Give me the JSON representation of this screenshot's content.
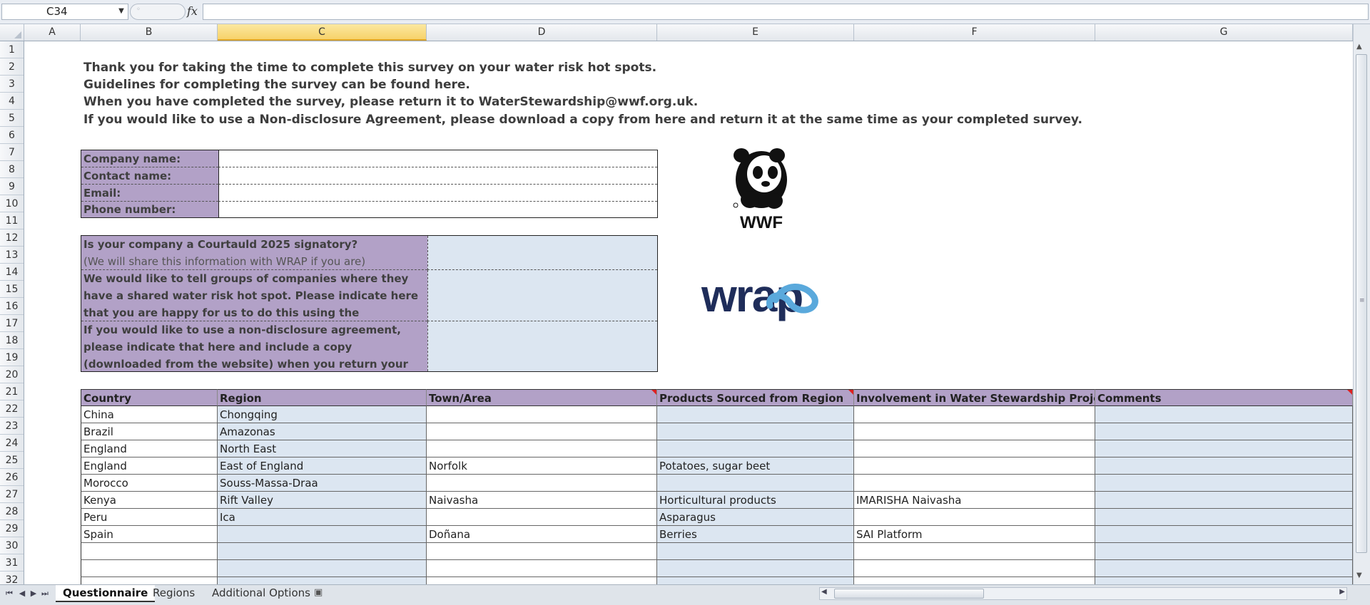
{
  "formula_bar": {
    "name_box": "C34",
    "formula": ""
  },
  "columns": [
    "A",
    "B",
    "C",
    "D",
    "E",
    "F",
    "G"
  ],
  "selected_column": "C",
  "rows": [
    "1",
    "2",
    "3",
    "4",
    "5",
    "6",
    "7",
    "8",
    "9",
    "10",
    "11",
    "12",
    "13",
    "14",
    "15",
    "16",
    "17",
    "18",
    "19",
    "20",
    "21",
    "22",
    "23",
    "24",
    "25",
    "26",
    "27",
    "28",
    "29",
    "30",
    "31",
    "32"
  ],
  "intro": [
    "Thank you for taking the time to complete this survey on your water risk hot spots.",
    "Guidelines for completing the survey can be found here.",
    "When you have completed the survey, please return it to WaterStewardship@wwf.org.uk.",
    "If you would like to use a Non-disclosure Agreement, please download a copy from here and return it at the same time as your completed survey."
  ],
  "contact_fields": [
    "Company name:",
    "Contact name:",
    "Email:",
    "Phone number:"
  ],
  "questions": {
    "courtauld": "Is your company a Courtauld 2025 signatory?",
    "courtauld_note": "(We will share this information with WRAP if you are)",
    "share": "We would like to tell groups of companies where they have a shared water risk hot spot. Please indicate here that you are happy for us to do this using the information you provide.",
    "nda": "If you would like to use a non-disclosure agreement, please indicate that here and include a copy (downloaded from the website) when you return your survey."
  },
  "logos": {
    "wwf": "WWF",
    "wrap": "wrap"
  },
  "table": {
    "headers": [
      "Country",
      "Region",
      "Town/Area",
      "Products Sourced from Region",
      "Involvement in Water Stewardship Projects",
      "Comments"
    ],
    "rows": [
      [
        "China",
        "Chongqing",
        "",
        "",
        "",
        ""
      ],
      [
        "Brazil",
        "Amazonas",
        "",
        "",
        "",
        ""
      ],
      [
        "England",
        "North East",
        "",
        "",
        "",
        ""
      ],
      [
        "England",
        "East of England",
        "Norfolk",
        "Potatoes, sugar beet",
        "",
        ""
      ],
      [
        "Morocco",
        "Souss-Massa-Draa",
        "",
        "",
        "",
        ""
      ],
      [
        "Kenya",
        "Rift Valley",
        "Naivasha",
        "Horticultural products",
        "IMARISHA Naivasha",
        ""
      ],
      [
        "Peru",
        "Ica",
        "",
        "Asparagus",
        "",
        ""
      ],
      [
        "Spain",
        "",
        "Doñana",
        "Berries",
        "SAI Platform",
        ""
      ],
      [
        "",
        "",
        "",
        "",
        "",
        ""
      ],
      [
        "",
        "",
        "",
        "",
        "",
        ""
      ],
      [
        "",
        "",
        "",
        "",
        "",
        ""
      ]
    ]
  },
  "tabs": [
    "Questionnaire",
    "Regions",
    "Additional Options"
  ],
  "active_tab": "Questionnaire",
  "colors": {
    "label_purple": "#b2a1c7",
    "answer_blue": "#dce6f1",
    "selected_header": "#f7d36a"
  }
}
